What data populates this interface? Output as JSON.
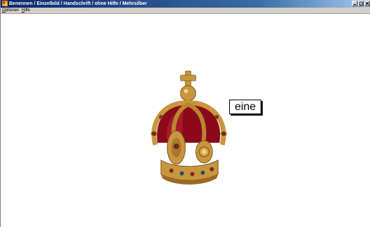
{
  "window": {
    "title": "Benennen / Einzelbild / Handschrift / ohne Hilfe / Mehrsilber"
  },
  "menubar": {
    "items": [
      {
        "label": "Optionen",
        "underline": "O"
      },
      {
        "label": "Hilfe",
        "underline": "H"
      }
    ]
  },
  "main": {
    "image_subject": "crown-image",
    "word_card": "eine"
  },
  "colors": {
    "titlebar_start": "#0a246a",
    "titlebar_end": "#a6caf0",
    "crown_velvet": "#8b0a1a",
    "crown_gold": "#c8963c"
  }
}
